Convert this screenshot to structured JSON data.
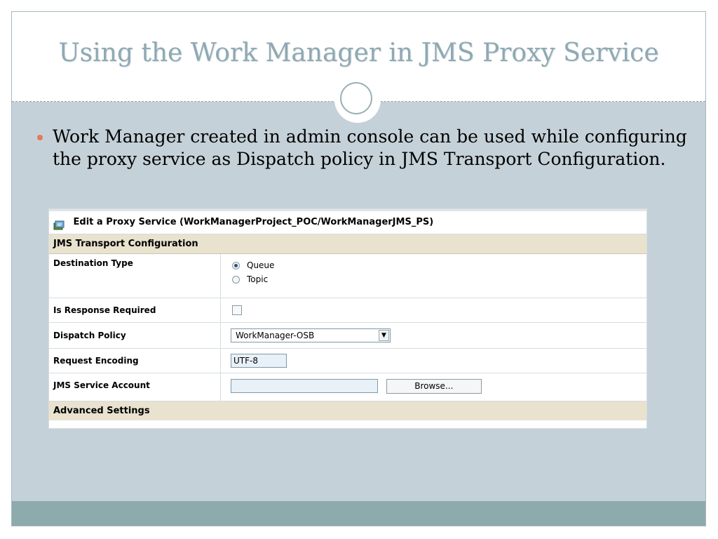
{
  "slide": {
    "title": "Using the Work Manager in JMS Proxy Service",
    "bullet": "Work Manager created in admin console can be used while configuring the proxy service as Dispatch policy in JMS Transport Configuration."
  },
  "panel": {
    "header": "Edit a Proxy Service (WorkManagerProject_POC/WorkManagerJMS_PS)",
    "section": "JMS Transport Configuration",
    "rows": {
      "destination_type": {
        "label": "Destination Type",
        "options": [
          "Queue",
          "Topic"
        ],
        "selected": "Queue"
      },
      "is_response_required": {
        "label": "Is Response Required",
        "checked": false
      },
      "dispatch_policy": {
        "label": "Dispatch Policy",
        "value": "WorkManager-OSB"
      },
      "request_encoding": {
        "label": "Request Encoding",
        "value": "UTF-8"
      },
      "jms_service_account": {
        "label": "JMS Service Account",
        "value": "",
        "browse_label": "Browse..."
      }
    },
    "advanced": "Advanced Settings"
  },
  "colors": {
    "title": "#8fa9b3",
    "slide_bg": "#c5d1d8",
    "bullet": "#e47a5b",
    "section_bg": "#e8e2cf",
    "footer": "#8daaad"
  }
}
